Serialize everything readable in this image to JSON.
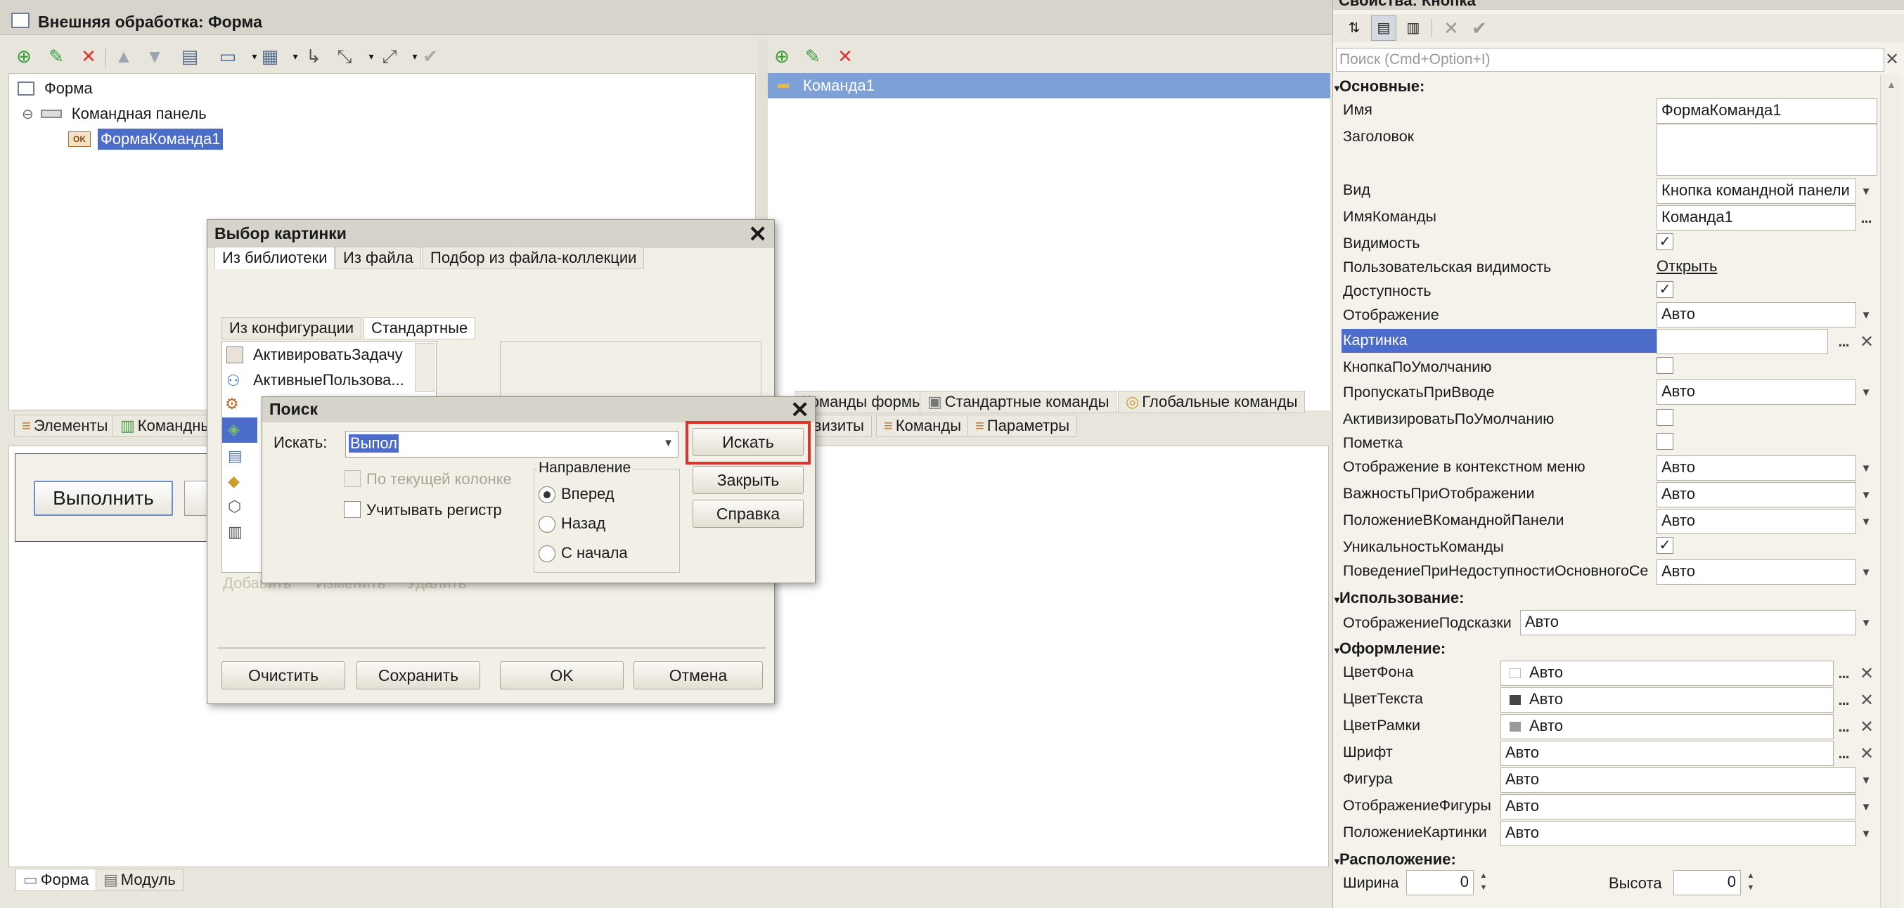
{
  "window": {
    "title": "Внешняя обработка: Форма"
  },
  "left_tree": {
    "items": [
      "Форма",
      "Командная панель",
      "ФормаКоманда1"
    ]
  },
  "commands_list": {
    "items": [
      "Команда1"
    ]
  },
  "lower_tabs_left": [
    "Элементы",
    "Командный интерфейс"
  ],
  "lower_tabs_right_top": [
    "Команды формы",
    "Стандартные команды",
    "Глобальные команды"
  ],
  "lower_tabs_right_bottom": [
    "Реквизиты",
    "Команды",
    "Параметры"
  ],
  "preview": {
    "button_label": "Выполнить"
  },
  "bottom_tabs": [
    "Форма",
    "Модуль"
  ],
  "picture_dialog": {
    "title": "Выбор картинки",
    "tabs": [
      "Из библиотеки",
      "Из файла",
      "Подбор из файла-коллекции"
    ],
    "subtabs": [
      "Из конфигурации",
      "Стандартные"
    ],
    "list": [
      "АктивироватьЗадачу",
      "АктивныеПользова..."
    ],
    "faded_buttons": [
      "Добавить",
      "Изменить",
      "Удалить"
    ],
    "buttons": [
      "Очистить",
      "Сохранить",
      "OK",
      "Отмена"
    ]
  },
  "search_dialog": {
    "title": "Поиск",
    "search_label": "Искать:",
    "search_value": "Выпол",
    "find_button": "Искать",
    "close_button": "Закрыть",
    "help_button": "Справка",
    "by_column": "По текущей колонке",
    "case_sensitive": "Учитывать регистр",
    "direction_label": "Направление",
    "directions": [
      "Вперед",
      "Назад",
      "С начала"
    ],
    "selected_direction": "Вперед",
    "highlight_color": "#e0322a"
  },
  "properties": {
    "title": "Свойства: Кнопка",
    "search_placeholder": "Поиск (Cmd+Option+I)",
    "sections": {
      "main": "Основные:",
      "usage": "Использование:",
      "design": "Оформление:",
      "layout": "Расположение:"
    },
    "main": [
      {
        "label": "Имя",
        "value": "ФормаКоманда1"
      },
      {
        "label": "Заголовок",
        "value": ""
      },
      {
        "label": "Вид",
        "value": "Кнопка командной панели"
      },
      {
        "label": "ИмяКоманды",
        "value": "Команда1"
      },
      {
        "label": "Видимость",
        "checked": true
      },
      {
        "label": "Пользовательская видимость",
        "link": "Открыть"
      },
      {
        "label": "Доступность",
        "checked": true
      },
      {
        "label": "Отображение",
        "value": "Авто"
      },
      {
        "label": "Картинка",
        "value": ""
      },
      {
        "label": "КнопкаПоУмолчанию",
        "checked": false
      },
      {
        "label": "ПропускатьПриВводе",
        "value": "Авто"
      },
      {
        "label": "АктивизироватьПоУмолчанию",
        "checked": false
      },
      {
        "label": "Пометка",
        "checked": false
      },
      {
        "label": "Отображение в контекстном меню",
        "value": "Авто"
      },
      {
        "label": "ВажностьПриОтображении",
        "value": "Авто"
      },
      {
        "label": "ПоложениеВКоманднойПанели",
        "value": "Авто"
      },
      {
        "label": "УникальностьКоманды",
        "checked": true
      },
      {
        "label": "ПоведениеПриНедоступностиОсновногоСе",
        "value": "Авто"
      }
    ],
    "usage": [
      {
        "label": "ОтображениеПодсказки",
        "value": "Авто"
      }
    ],
    "design": [
      {
        "label": "ЦветФона",
        "value": "Авто"
      },
      {
        "label": "ЦветТекста",
        "value": "Авто"
      },
      {
        "label": "ЦветРамки",
        "value": "Авто"
      },
      {
        "label": "Шрифт",
        "value": "Авто"
      },
      {
        "label": "Фигура",
        "value": "Авто"
      },
      {
        "label": "ОтображениеФигуры",
        "value": "Авто"
      },
      {
        "label": "ПоложениеКартинки",
        "value": "Авто"
      }
    ],
    "layout": {
      "width_label": "Ширина",
      "width_value": "0",
      "height_label": "Высота",
      "height_value": "0"
    },
    "selected_color": "#4b6cc8"
  }
}
